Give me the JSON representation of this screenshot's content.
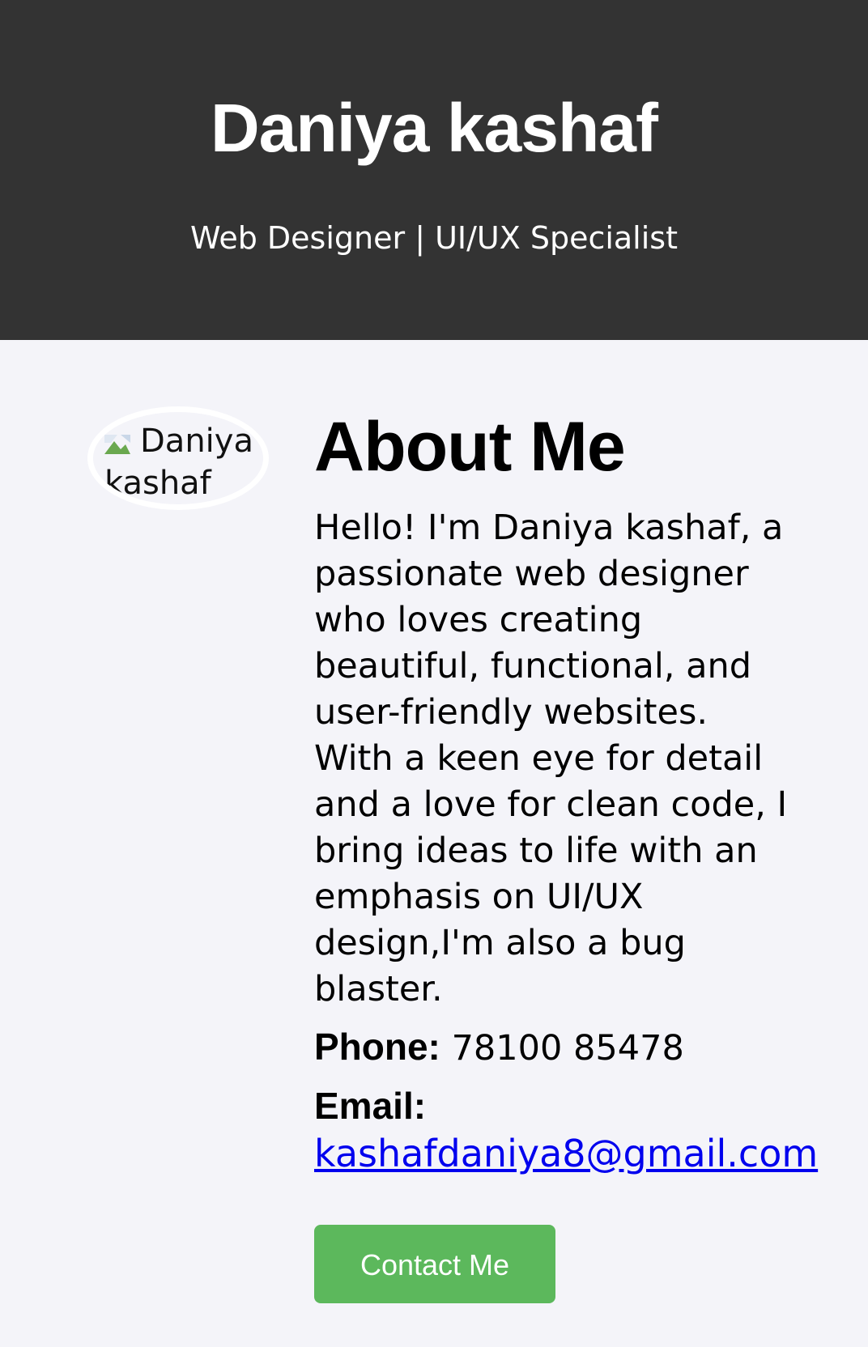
{
  "header": {
    "name": "Daniya kashaf",
    "subtitle": "Web Designer | UI/UX Specialist"
  },
  "profile": {
    "image_alt": "Daniya kashaf"
  },
  "about": {
    "title": "About Me",
    "text": "Hello! I'm Daniya kashaf, a passionate web designer who loves creating beautiful, functional, and user-friendly websites. With a keen eye for detail and a love for clean code, I bring ideas to life with an emphasis on UI/UX design,I'm also a bug blaster.",
    "phone_label": "Phone:",
    "phone_value": "78100 85478",
    "email_label": "Email:",
    "email_value": "kashafdaniya8@gmail.com",
    "contact_button": "Contact Me"
  },
  "colors": {
    "header_bg": "#333333",
    "page_bg": "#f4f4f9",
    "button_bg": "#5cb85c",
    "link": "#0000ee"
  }
}
